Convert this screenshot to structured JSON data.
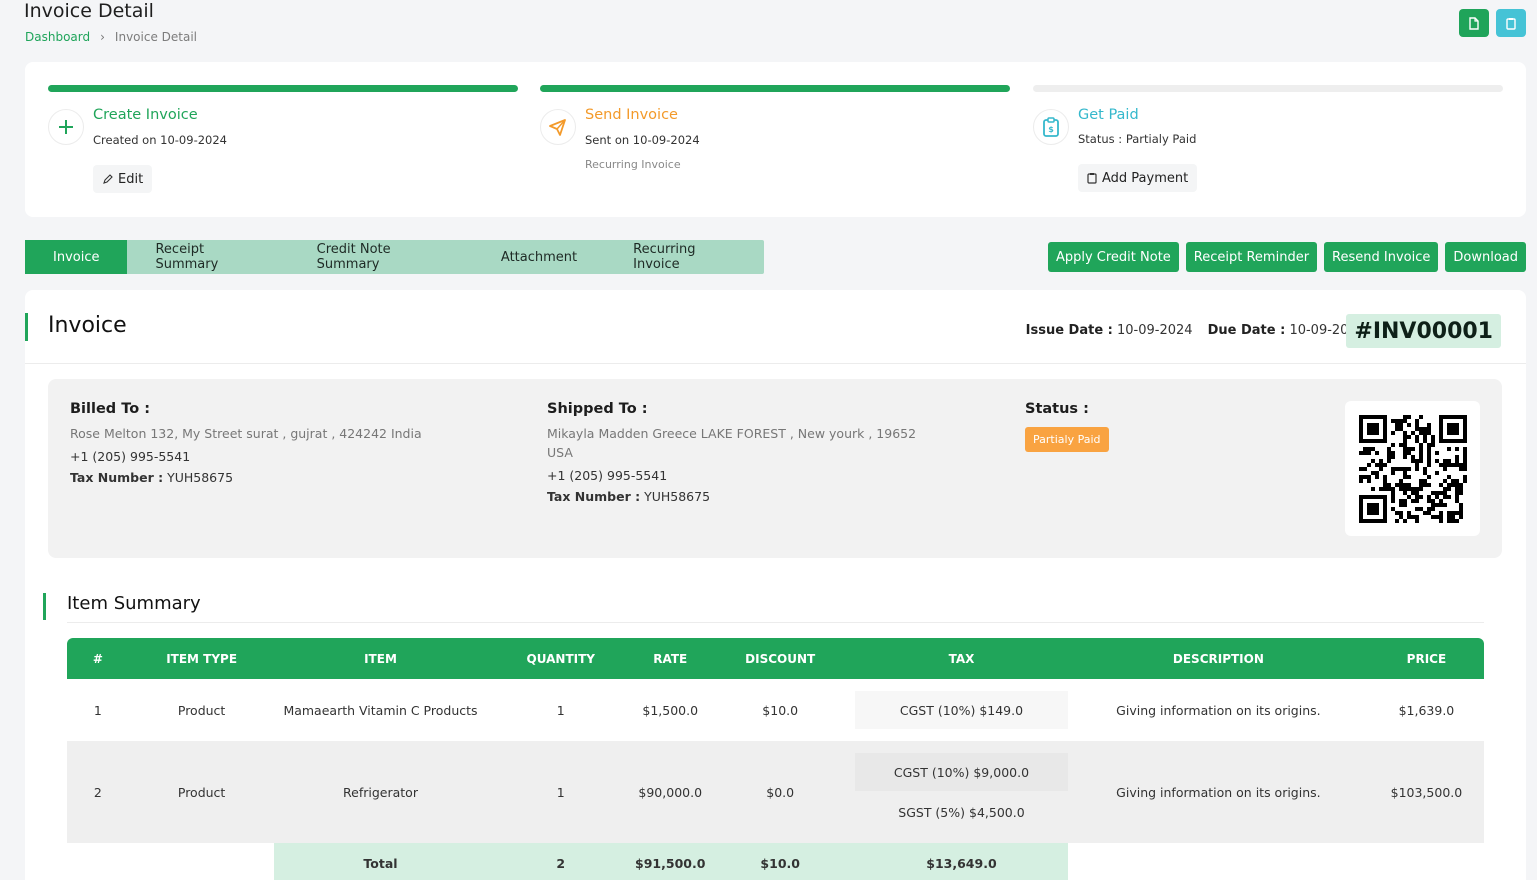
{
  "page": {
    "title": "Invoice Detail"
  },
  "breadcrumb": {
    "home": "Dashboard",
    "separator": "›",
    "current": "Invoice Detail"
  },
  "top_buttons": [
    {
      "icon": "file-icon",
      "color": "#1fa45a"
    },
    {
      "icon": "clipboard-icon",
      "color": "#45c3d6"
    }
  ],
  "steps": [
    {
      "title": "Create Invoice",
      "sub": "Created on 10-09-2024",
      "button": "Edit",
      "color": "#20a55a",
      "done": true
    },
    {
      "title": "Send Invoice",
      "sub": "Sent on 10-09-2024",
      "sub2": "Recurring Invoice",
      "color": "#f39a2a",
      "done": true
    },
    {
      "title": "Get Paid",
      "sub": "Status : Partialy Paid",
      "button": "Add Payment",
      "color": "#35b8cc",
      "done": false
    }
  ],
  "tabs": [
    "Invoice",
    "Receipt Summary",
    "Credit Note Summary",
    "Attachment",
    "Recurring Invoice"
  ],
  "active_tab": "Invoice",
  "actions": [
    "Apply Credit Note",
    "Receipt Reminder",
    "Resend Invoice",
    "Download"
  ],
  "invoice": {
    "heading": "Invoice",
    "issue_label": "Issue Date :",
    "issue_date": "10-09-2024",
    "due_label": "Due Date :",
    "due_date": "10-09-2025",
    "number": "#INV00001"
  },
  "billed": {
    "heading": "Billed To :",
    "address": "Rose Melton 132, My Street surat , gujrat , 424242 India",
    "phone": "+1 (205) 995-5541",
    "tax_label": "Tax Number :",
    "tax": "YUH58675"
  },
  "shipped": {
    "heading": "Shipped To :",
    "address": "Mikayla Madden Greece LAKE FOREST , New yourk , 19652 USA",
    "phone": "+1 (205) 995-5541",
    "tax_label": "Tax Number :",
    "tax": "YUH58675"
  },
  "status": {
    "heading": "Status :",
    "badge": "Partialy Paid",
    "badge_color": "#f9a341"
  },
  "summary": {
    "title": "Item Summary",
    "columns": [
      "#",
      "ITEM TYPE",
      "ITEM",
      "QUANTITY",
      "RATE",
      "DISCOUNT",
      "TAX",
      "DESCRIPTION",
      "PRICE"
    ],
    "rows": [
      {
        "no": "1",
        "type": "Product",
        "item": "Mamaearth Vitamin C Products",
        "qty": "1",
        "rate": "$1,500.0",
        "discount": "$10.0",
        "taxes": [
          "CGST (10%) $149.0"
        ],
        "desc": "Giving information on its origins.",
        "price": "$1,639.0"
      },
      {
        "no": "2",
        "type": "Product",
        "item": "Refrigerator",
        "qty": "1",
        "rate": "$90,000.0",
        "discount": "$0.0",
        "taxes": [
          "CGST (10%) $9,000.0",
          "SGST (5%) $4,500.0"
        ],
        "desc": "Giving information on its origins.",
        "price": "$103,500.0"
      }
    ],
    "total": {
      "label": "Total",
      "qty": "2",
      "rate": "$91,500.0",
      "discount": "$10.0",
      "tax": "$13,649.0"
    }
  }
}
